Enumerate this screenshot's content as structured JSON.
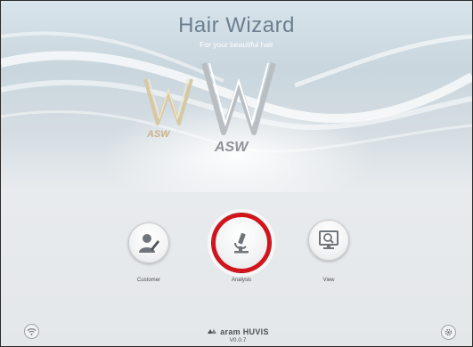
{
  "app": {
    "title": "Hair Wizard",
    "subtitle": "For your beautiful hair"
  },
  "logo": {
    "small_text": "ASW",
    "big_text": "ASW",
    "small_color": "#c9b48a",
    "big_color": "#8d9297"
  },
  "menu": {
    "customer_label": "Customer",
    "analysis_label": "Analysis",
    "view_label": "View",
    "customer_icon": "person-pen-icon",
    "analysis_icon": "microscope-icon",
    "view_icon": "monitor-magnifier-icon",
    "selected": "Analysis",
    "selected_ring_color": "#d3131a"
  },
  "footer": {
    "brand": "aram HUVIS",
    "version": "V0.0.7",
    "left_icon": "wifi-icon",
    "right_icon": "gear-icon"
  }
}
